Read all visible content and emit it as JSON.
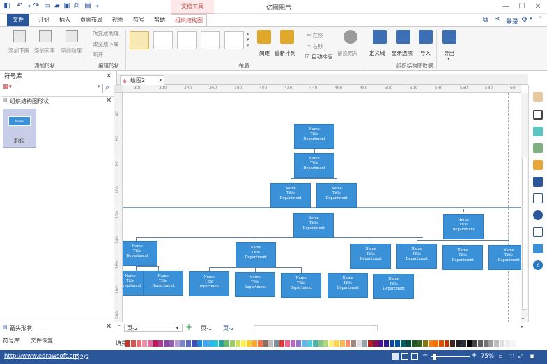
{
  "titlebar": {
    "doc_title": "亿图图示",
    "context_tab": "文档工具"
  },
  "tabs": [
    {
      "label": "文件",
      "kind": "file"
    },
    {
      "label": "开始",
      "kind": "normal"
    },
    {
      "label": "插入",
      "kind": "normal"
    },
    {
      "label": "页面布局",
      "kind": "normal"
    },
    {
      "label": "视图",
      "kind": "normal"
    },
    {
      "label": "符号",
      "kind": "normal"
    },
    {
      "label": "帮助",
      "kind": "normal"
    },
    {
      "label": "组织结构图",
      "kind": "active"
    }
  ],
  "login": "登录",
  "ribbon": {
    "add_shape": {
      "buttons": [
        "添加下属",
        "添加同事",
        "添加助理"
      ],
      "group": "添加形状"
    },
    "edit_shape": {
      "items": [
        "改变成助理",
        "改变成下属",
        "断开"
      ],
      "group": "编辑形状"
    },
    "layout": {
      "spacing": "间距",
      "rearrange": "重新排列",
      "left": "左移",
      "right": "右移",
      "auto": "自动排版",
      "replace": "替换照片",
      "group": "布局"
    },
    "data": {
      "buttons": [
        "定义域",
        "显示选项",
        "导入",
        "导出"
      ],
      "group": "组织结构图数据"
    }
  },
  "left_panel": {
    "title": "符号库",
    "shapes_header": "组织结构图形状",
    "tile_label": "职位",
    "tile_inner": "Name",
    "lower_title": "箭头形状",
    "bottom_tabs": [
      "符号库",
      "文件恢复"
    ]
  },
  "document": {
    "tab": "绘图2",
    "ruler_h": [
      "300",
      "320",
      "340",
      "360",
      "380",
      "400",
      "420",
      "440",
      "460",
      "480",
      "500",
      "520",
      "540",
      "560",
      "580",
      "60"
    ],
    "ruler_v": [
      "40",
      "60",
      "80",
      "100",
      "120",
      "140",
      "160",
      "180",
      "200"
    ]
  },
  "node_text": {
    "name": "Name",
    "title": "Title",
    "dept": "Department"
  },
  "pages": {
    "current_select": "页-2",
    "page1": "页-1",
    "page2": "页-2"
  },
  "fill_label": "填充",
  "status": {
    "url": "http://www.edrawsoft.cn/",
    "page": "页2/2",
    "zoom": "75%"
  },
  "colors": {
    "accent": "#2b579a",
    "node_fill": "#3b91d8",
    "context_red": "#c0504d"
  }
}
